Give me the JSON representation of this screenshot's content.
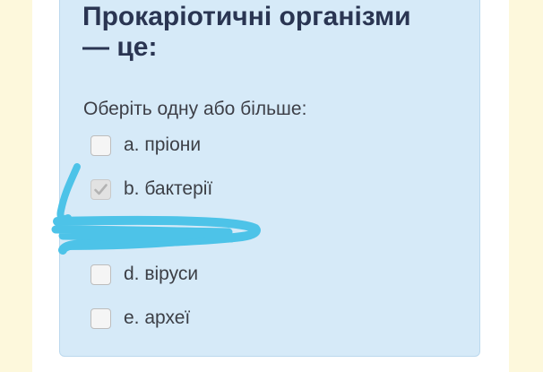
{
  "question": {
    "title": "Прокаріотичні організми — це:",
    "prompt": "Оберіть одну або більше:"
  },
  "options": [
    {
      "letter": "a.",
      "text": "пріони",
      "checked": false
    },
    {
      "letter": "b.",
      "text": "бактерії",
      "checked": true
    },
    {
      "letter": "d.",
      "text": "віруси",
      "checked": false
    },
    {
      "letter": "e.",
      "text": "археї",
      "checked": false
    }
  ],
  "colors": {
    "page_background": "#fdf8dc",
    "card_background": "#d6eaf8",
    "title_color": "#2a3552",
    "annotation_marker": "#4dc3e8"
  }
}
